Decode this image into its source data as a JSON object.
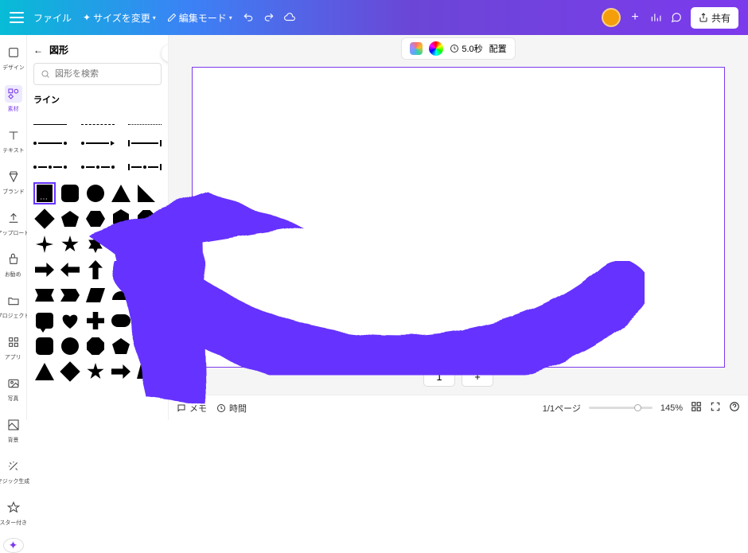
{
  "topbar": {
    "file": "ファイル",
    "resize": "サイズを変更",
    "edit_mode": "編集モード",
    "share": "共有"
  },
  "rail": {
    "design": "デザイン",
    "elements": "素材",
    "text": "テキスト",
    "brand": "ブランド",
    "upload": "アップロード",
    "recommend": "お勧め",
    "project": "プロジェクト",
    "apps": "アプリ",
    "photos": "写真",
    "background": "背景",
    "magic": "マジック生成",
    "starred": "スター付き"
  },
  "panel": {
    "title": "図形",
    "search_placeholder": "図形を検索",
    "section_line": "ライン"
  },
  "context": {
    "duration": "5.0秒",
    "position": "配置"
  },
  "page": {
    "current": "1"
  },
  "footer": {
    "memo": "メモ",
    "duration": "時間",
    "pages": "1/1ページ",
    "zoom": "145%"
  }
}
